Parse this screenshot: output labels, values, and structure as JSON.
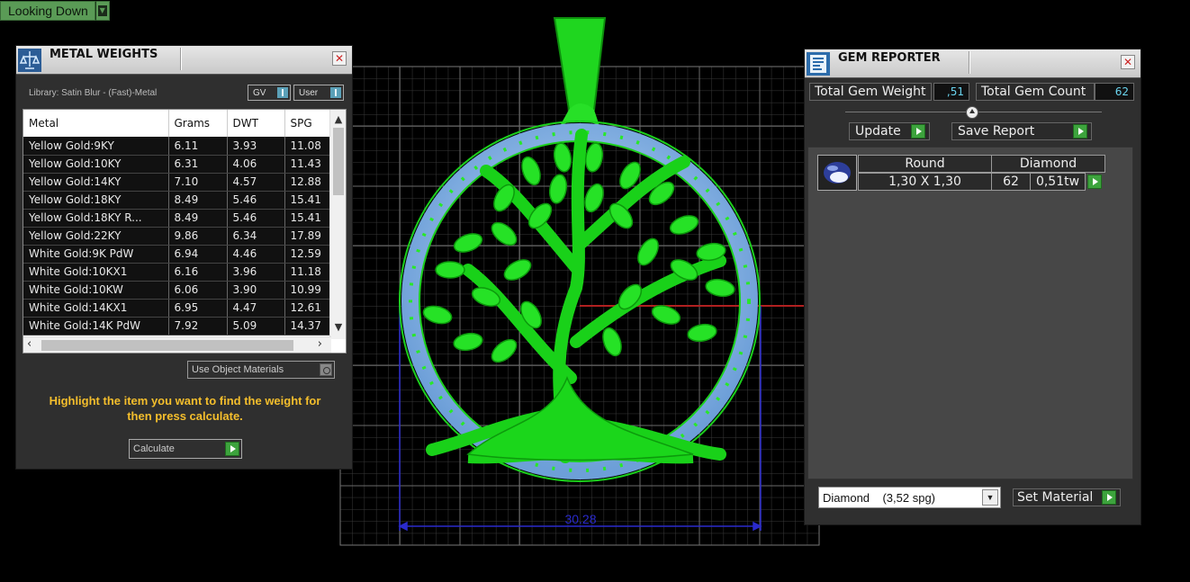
{
  "view_dropdown": {
    "label": "Looking Down"
  },
  "viewport": {
    "dimension_label": "30.28"
  },
  "metal_panel": {
    "title": "METAL WEIGHTS",
    "library_text": "Library: Satin Blur - (Fast)-Metal",
    "toggle_gv": "GV",
    "toggle_user": "User",
    "columns": [
      "Metal",
      "Grams",
      "DWT",
      "SPG"
    ],
    "rows": [
      [
        "Yellow Gold:9KY",
        "6.11",
        "3.93",
        "11.08"
      ],
      [
        "Yellow Gold:10KY",
        "6.31",
        "4.06",
        "11.43"
      ],
      [
        "Yellow Gold:14KY",
        "7.10",
        "4.57",
        "12.88"
      ],
      [
        "Yellow Gold:18KY",
        "8.49",
        "5.46",
        "15.41"
      ],
      [
        "Yellow Gold:18KY R...",
        "8.49",
        "5.46",
        "15.41"
      ],
      [
        "Yellow Gold:22KY",
        "9.86",
        "6.34",
        "17.89"
      ],
      [
        "White Gold:9K PdW",
        "6.94",
        "4.46",
        "12.59"
      ],
      [
        "White Gold:10KX1",
        "6.16",
        "3.96",
        "11.18"
      ],
      [
        "White Gold:10KW",
        "6.06",
        "3.90",
        "10.99"
      ],
      [
        "White Gold:14KX1",
        "6.95",
        "4.47",
        "12.61"
      ],
      [
        "White Gold:14K PdW",
        "7.92",
        "5.09",
        "14.37"
      ]
    ],
    "use_object_materials": "Use Object Materials",
    "hint": "Highlight the item you want to find the weight for then press calculate.",
    "calculate": "Calculate"
  },
  "gem_panel": {
    "title": "GEM REPORTER",
    "total_weight_label": "Total Gem Weight",
    "total_weight_value": ",51",
    "total_count_label": "Total Gem Count",
    "total_count_value": "62",
    "update": "Update",
    "save_report": "Save Report",
    "gem": {
      "shape": "Round",
      "material": "Diamond",
      "size": "1,30 X 1,30",
      "count": "62",
      "weight": "0,51tw"
    },
    "material_select": "Diamond    (3,52 spg)",
    "set_material": "Set Material"
  },
  "colors": {
    "accent_green": "#3da33d",
    "model_green": "#22e022",
    "gem_blue": "#8ab8e8",
    "hint_yellow": "#f4be2c"
  }
}
